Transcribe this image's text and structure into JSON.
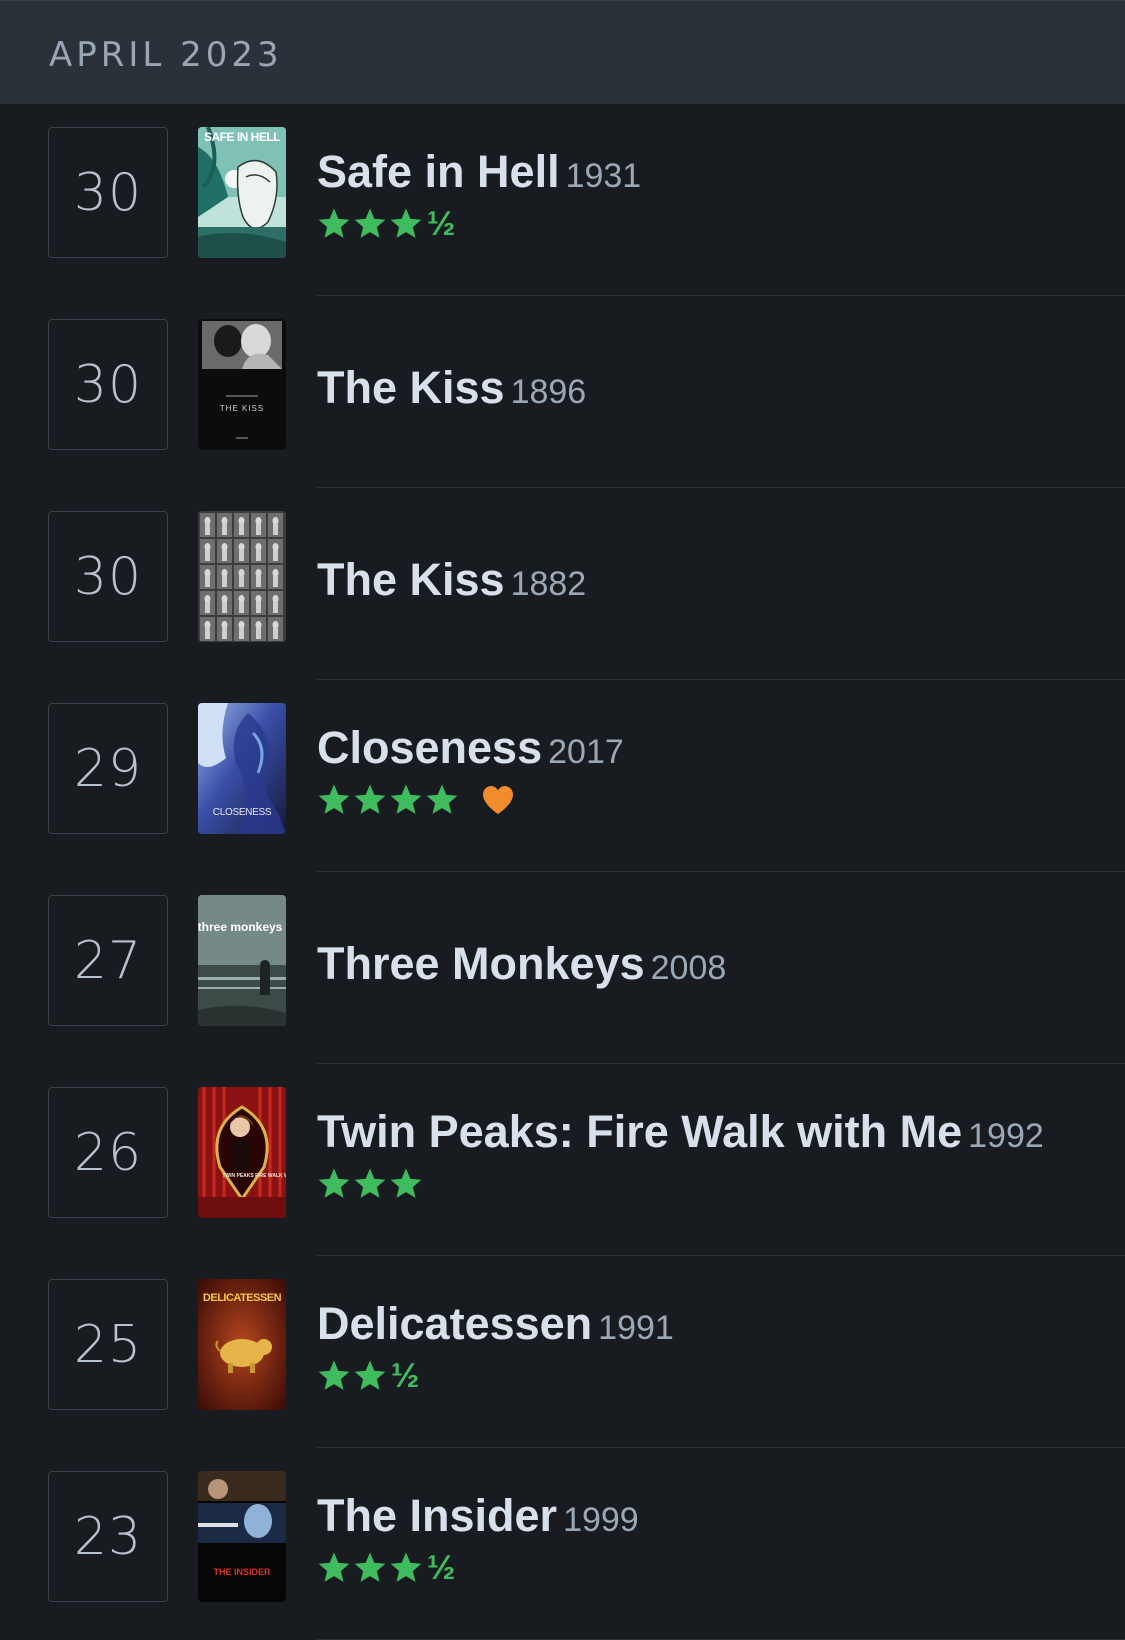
{
  "month_header": {
    "label": "APRIL 2023"
  },
  "colors": {
    "star": "#40bc5e",
    "heart": "#f08c2c",
    "background": "#181b20",
    "header_bg": "#2b3139"
  },
  "entries": [
    {
      "day": "30",
      "title": "Safe in Hell",
      "year": "1931",
      "stars": 3,
      "half": true,
      "half_glyph": "½",
      "liked": false,
      "poster_name": "safe-in-hell-poster"
    },
    {
      "day": "30",
      "title": "The Kiss",
      "year": "1896",
      "stars": 0,
      "half": false,
      "half_glyph": "",
      "liked": false,
      "poster_name": "the-kiss-1896-poster"
    },
    {
      "day": "30",
      "title": "The Kiss",
      "year": "1882",
      "stars": 0,
      "half": false,
      "half_glyph": "",
      "liked": false,
      "poster_name": "the-kiss-1882-poster"
    },
    {
      "day": "29",
      "title": "Closeness",
      "year": "2017",
      "stars": 4,
      "half": false,
      "half_glyph": "",
      "liked": true,
      "poster_name": "closeness-poster"
    },
    {
      "day": "27",
      "title": "Three Monkeys",
      "year": "2008",
      "stars": 0,
      "half": false,
      "half_glyph": "",
      "liked": false,
      "poster_name": "three-monkeys-poster"
    },
    {
      "day": "26",
      "title": "Twin Peaks: Fire Walk with Me",
      "year": "1992",
      "stars": 3,
      "half": false,
      "half_glyph": "",
      "liked": false,
      "poster_name": "twin-peaks-poster"
    },
    {
      "day": "25",
      "title": "Delicatessen",
      "year": "1991",
      "stars": 2,
      "half": true,
      "half_glyph": "½",
      "liked": false,
      "poster_name": "delicatessen-poster"
    },
    {
      "day": "23",
      "title": "The Insider",
      "year": "1999",
      "stars": 3,
      "half": true,
      "half_glyph": "½",
      "liked": false,
      "poster_name": "the-insider-poster"
    }
  ],
  "posters": {
    "safe-in-hell-poster": {
      "text": "SAFE IN HELL",
      "text_color": "#ffffff"
    },
    "the-kiss-1896-poster": {
      "text": "THE KISS",
      "text_color": "#cfcfcf"
    },
    "the-kiss-1882-poster": {
      "text": "",
      "text_color": "#cfcfcf"
    },
    "closeness-poster": {
      "text": "CLOSENESS",
      "text_color": "#e7e7f2"
    },
    "three-monkeys-poster": {
      "text": "three monkeys",
      "text_color": "#ffffff"
    },
    "twin-peaks-poster": {
      "text": "TWIN PEAKS FIRE WALK WITH ME",
      "text_color": "#f0e6d8"
    },
    "delicatessen-poster": {
      "text": "DELICATESSEN",
      "text_color": "#f0c94a"
    },
    "the-insider-poster": {
      "text": "THE INSIDER",
      "text_color": "#d8342c"
    }
  }
}
